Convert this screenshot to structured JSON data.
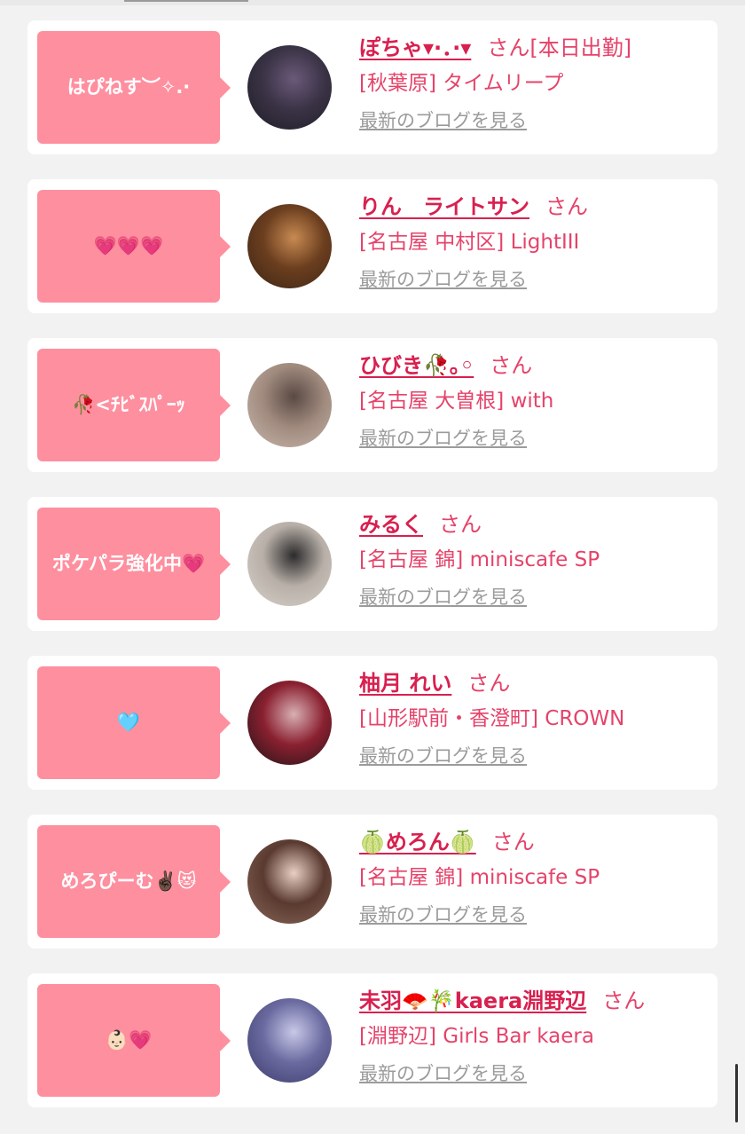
{
  "cards": [
    {
      "bubble": "はぴねす︶✧.·",
      "name": "ぽちゃ▾·．·▾",
      "san": "さん",
      "suffix": "[本日出勤]",
      "shop": "[秋葉原] タイムリープ",
      "blog": "最新のブログを見る",
      "avatar_colors": [
        "#1c1c24",
        "#6a5a7a",
        "#3b3346"
      ]
    },
    {
      "bubble": "💗💗💗",
      "name": "りん　ライトサン",
      "san": "さん",
      "suffix": "",
      "shop": "[名古屋 中村区] LightIII",
      "blog": "最新のブログを見る",
      "avatar_colors": [
        "#3a2414",
        "#c88a52",
        "#6b3e1f"
      ]
    },
    {
      "bubble": "🥀<ﾁﾋﾞｽﾊﾟｰｯ",
      "name": "ひびき🥀｡◦",
      "san": "さん",
      "suffix": "",
      "shop": "[名古屋 大曽根] with",
      "blog": "最新のブログを見る",
      "avatar_colors": [
        "#c9b8ae",
        "#5a4a44",
        "#a08a7e"
      ]
    },
    {
      "bubble": "ポケパラ強化中💗",
      "name": "みるく",
      "san": "さん",
      "suffix": "",
      "shop": "[名古屋 錦] miniscafe SP",
      "blog": "最新のブログを見る",
      "avatar_colors": [
        "#d8d2ca",
        "#2c2a2c",
        "#b8b0a8"
      ]
    },
    {
      "bubble": "🩵",
      "name": "柚月 れい",
      "san": "さん",
      "suffix": "",
      "shop": "[山形駅前・香澄町] CROWN",
      "blog": "最新のブログを見る",
      "avatar_colors": [
        "#1a1416",
        "#d8b0b4",
        "#8a2030"
      ]
    },
    {
      "bubble": "めろぴーむ✌🏿😻",
      "name": "🍈めろん🍈",
      "san": "さん",
      "suffix": "",
      "shop": "[名古屋 錦] miniscafe SP",
      "blog": "最新のブログを見る",
      "avatar_colors": [
        "#8a6a5a",
        "#e8cfc4",
        "#5a3a30"
      ]
    },
    {
      "bubble": "👶🏻💗",
      "name": "未羽🪭🎋kaera淵野辺",
      "san": "さん",
      "suffix": "",
      "shop": "[淵野辺] Girls Bar kaera",
      "blog": "最新のブログを見る",
      "avatar_colors": [
        "#3a3a6a",
        "#c8c8e8",
        "#6a6aa0"
      ]
    }
  ]
}
